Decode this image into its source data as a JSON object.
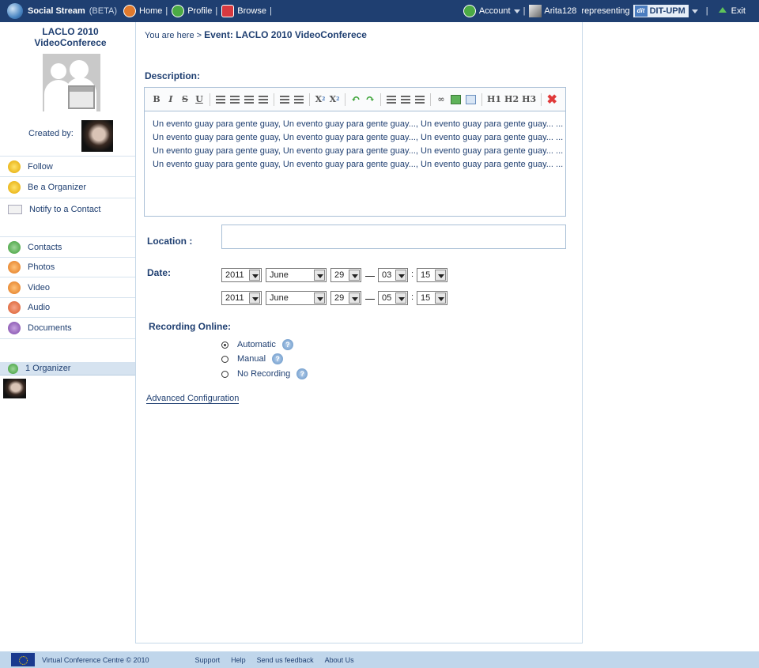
{
  "topbar": {
    "brand": "Social Stream",
    "beta": "(BETA)",
    "nav": [
      {
        "label": "Home",
        "sep": "|"
      },
      {
        "label": "Profile",
        "sep": "|"
      },
      {
        "label": "Browse",
        "sep": "|"
      }
    ],
    "account_label": "Account",
    "user_name": "Arita128",
    "representing_label": "representing",
    "org_name": "DIT-UPM",
    "org_logo_text": "dit",
    "right_sep": "|",
    "exit_label": "Exit",
    "colors": {
      "bar": "#1f3f71"
    }
  },
  "sidebar": {
    "event_title_line1": "LACLO 2010",
    "event_title_line2": "VideoConferece",
    "created_by_label": "Created by:",
    "actions": [
      {
        "label": "Follow",
        "icon": "star-icon"
      },
      {
        "label": "Be a Organizer",
        "icon": "star-icon"
      },
      {
        "label": "Notify to a Contact",
        "icon": "mail-icon"
      }
    ],
    "sections": [
      {
        "label": "Contacts",
        "icon": "contacts-icon"
      },
      {
        "label": "Photos",
        "icon": "photos-icon"
      },
      {
        "label": "Video",
        "icon": "video-icon"
      },
      {
        "label": "Audio",
        "icon": "audio-icon"
      },
      {
        "label": "Documents",
        "icon": "documents-icon"
      }
    ],
    "organizer_label": "1 Organizer"
  },
  "main": {
    "breadcrumb_prefix": "You are here >",
    "breadcrumb_current": "Event: LACLO 2010 VideoConferece",
    "description_label": "Description:",
    "editor_toolbar": {
      "bold": "B",
      "italic": "I",
      "strike": "S",
      "underline": "U",
      "subscript": "X",
      "superscript": "X",
      "h1": "H1",
      "h2": "H2",
      "h3": "H3"
    },
    "description_lines": [
      "Un evento guay para gente guay, Un evento guay para gente guay..., Un evento guay para gente guay... ...",
      "Un evento guay para gente guay, Un evento guay para gente guay..., Un evento guay para gente guay... ...",
      "Un evento guay para gente guay, Un evento guay para gente guay..., Un evento guay para gente guay... ...",
      "Un evento guay para gente guay, Un evento guay para gente guay..., Un evento guay para gente guay... ..."
    ],
    "location_label": "Location :",
    "location_value": "",
    "date_label": "Date:",
    "start": {
      "year": "2011",
      "month": "June",
      "day": "29",
      "hour": "03",
      "minute": "15"
    },
    "end": {
      "year": "2011",
      "month": "June",
      "day": "29",
      "hour": "05",
      "minute": "15"
    },
    "time_colon": ":",
    "recording_label": "Recording Online:",
    "recording_options": [
      {
        "label": "Automatic",
        "selected": true
      },
      {
        "label": "Manual",
        "selected": false
      },
      {
        "label": "No Recording",
        "selected": false
      }
    ],
    "help_glyph": "?",
    "advanced_label": "Advanced Configuration"
  },
  "footer": {
    "copyright": "Virtual Conference Centre © 2010",
    "links": [
      "Support",
      "Help",
      "Send us feedback",
      "About Us"
    ]
  }
}
